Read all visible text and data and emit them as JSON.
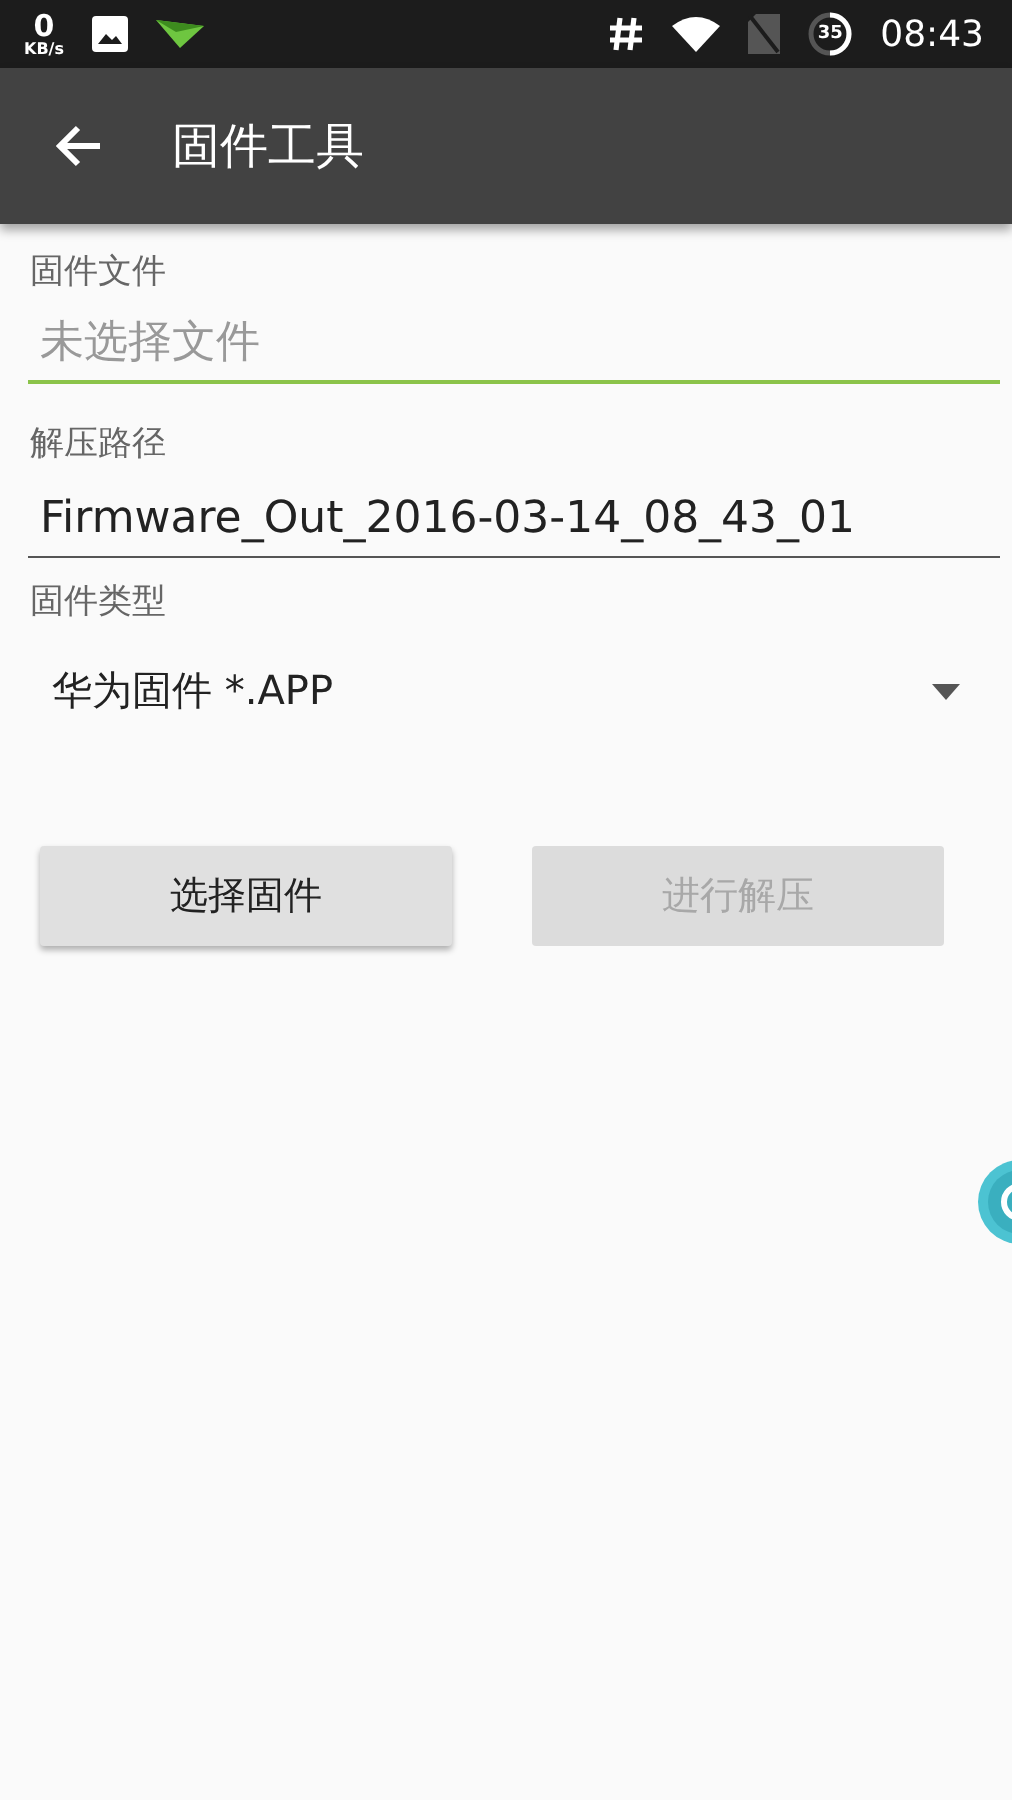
{
  "status_bar": {
    "net_speed": "0",
    "net_unit": "KB/s",
    "battery": "35",
    "time": "08:43"
  },
  "app_bar": {
    "title": "固件工具"
  },
  "firmware_file": {
    "label": "固件文件",
    "placeholder": "未选择文件",
    "focused": true
  },
  "output_path": {
    "label": "解压路径",
    "value": "Firmware_Out_2016-03-14_08_43_01",
    "focused": false
  },
  "firmware_type": {
    "label": "固件类型",
    "value": "华为固件 *.APP"
  },
  "buttons": [
    {
      "label": "选择固件",
      "disabled": false
    },
    {
      "label": "进行解压",
      "disabled": true
    }
  ]
}
